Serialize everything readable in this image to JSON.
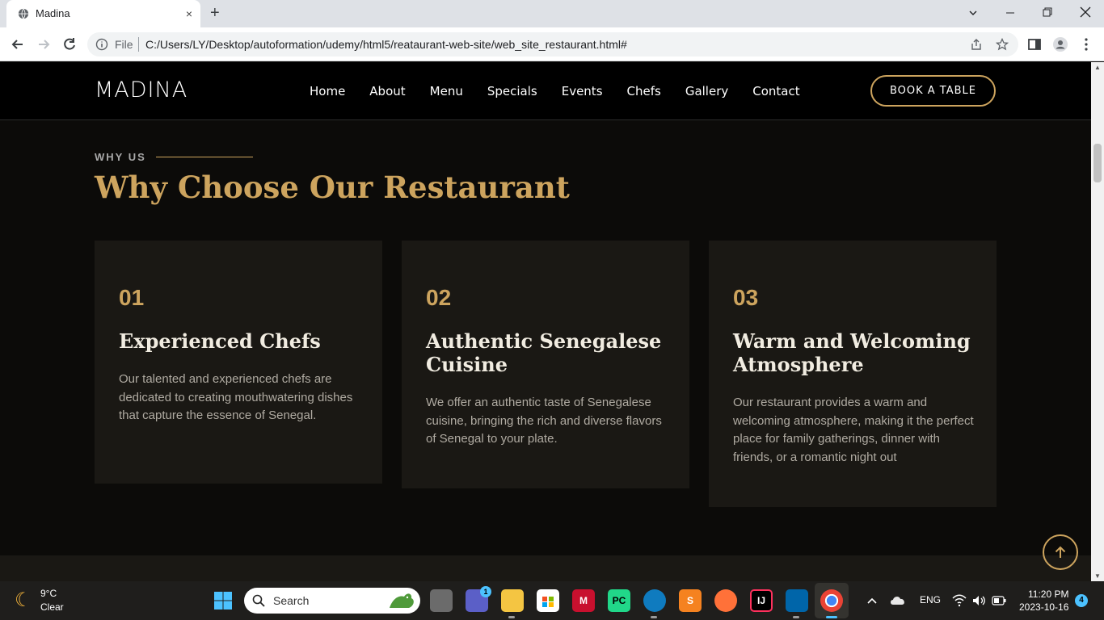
{
  "browser": {
    "tab_title": "Madina",
    "close_tab": "×",
    "new_tab": "+",
    "file_label": "File",
    "url": "C:/Users/LY/Desktop/autoformation/udemy/html5/reatau­rant-web-site/web_site_restaurant.html#"
  },
  "site": {
    "logo": "MADINA",
    "nav": [
      "Home",
      "About",
      "Menu",
      "Specials",
      "Events",
      "Chefs",
      "Gallery",
      "Contact"
    ],
    "book_button": "BOOK A TABLE",
    "section_label": "WHY US",
    "section_title": "Why Choose Our Restaurant",
    "cards": [
      {
        "num": "01",
        "title": "Experienced Chefs",
        "text": "Our talented and experienced chefs are dedicated to creating mouthwatering dishes that capture the essence of Senegal."
      },
      {
        "num": "02",
        "title": "Authentic Senegalese Cuisine",
        "text": "We offer an authentic taste of Senegalese cuisine, bringing the rich and diverse flavors of Senegal to your plate."
      },
      {
        "num": "03",
        "title": "Warm and Welcoming Atmosphere",
        "text": "Our restaurant provides a warm and welcoming atmosphere, making it the perfect place for family gatherings, dinner with friends, or a romantic night out"
      }
    ],
    "accent_color": "#cda45e"
  },
  "taskbar": {
    "weather_temp": "9°C",
    "weather_desc": "Clear",
    "search_placeholder": "Search",
    "chat_badge": "1",
    "language": "ENG",
    "time": "11:20 PM",
    "date": "2023-10-16",
    "notifications": "4"
  }
}
